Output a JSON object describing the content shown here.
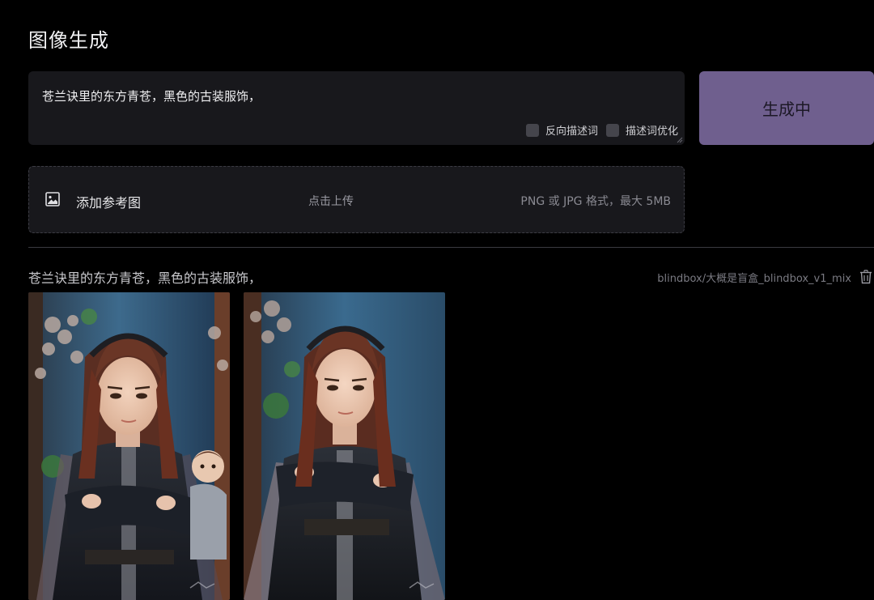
{
  "page": {
    "title": "图像生成"
  },
  "prompt": {
    "value": "苍兰诀里的东方青苍，黑色的古装服饰，",
    "options": [
      {
        "label": "反向描述词",
        "checked": false
      },
      {
        "label": "描述词优化",
        "checked": false
      }
    ]
  },
  "generate_button": {
    "label": "生成中",
    "color": "#6f5f8e"
  },
  "upload": {
    "label": "添加参考图",
    "hint": "点击上传",
    "format": "PNG 或 JPG 格式，最大 5MB"
  },
  "result": {
    "prompt": "苍兰诀里的东方青苍，黑色的古装服饰，",
    "model": "blindbox/大概是盲盒_blindbox_v1_mix",
    "images": [
      {
        "alt": "generated-image-1"
      },
      {
        "alt": "generated-image-2"
      }
    ]
  }
}
